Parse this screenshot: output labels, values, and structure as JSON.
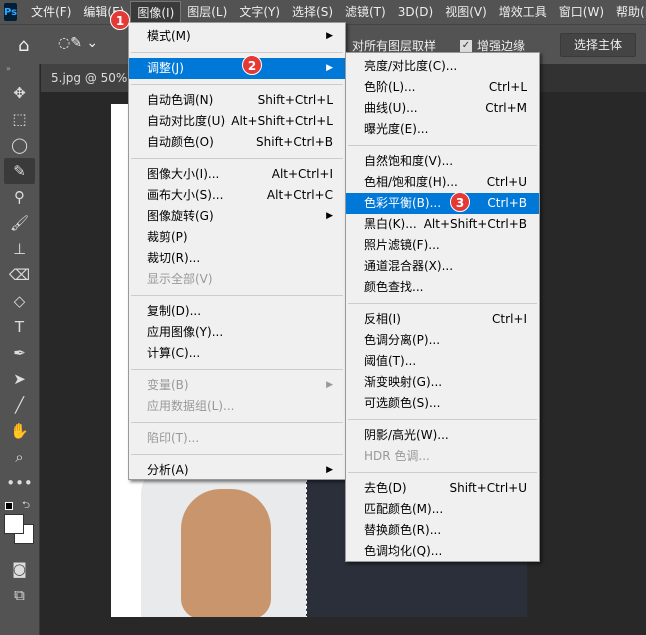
{
  "menubar": {
    "logo": "Ps",
    "items": [
      "文件(F)",
      "编辑(E)",
      "图像(I)",
      "图层(L)",
      "文字(Y)",
      "选择(S)",
      "滤镜(T)",
      "3D(D)",
      "视图(V)",
      "增效工具",
      "窗口(W)",
      "帮助(H)"
    ]
  },
  "options": {
    "sample_all_layers": "对所有图层取样",
    "enhance_edge": "增强边缘",
    "select_subject": "选择主体"
  },
  "tab": {
    "title": "5.jpg @ 50%(..."
  },
  "menu1": [
    {
      "label": "模式(M)",
      "shortcut": "",
      "sub": true
    },
    "sep",
    {
      "label": "调整(J)",
      "shortcut": "",
      "sub": true,
      "hl": true
    },
    "sep",
    {
      "label": "自动色调(N)",
      "shortcut": "Shift+Ctrl+L"
    },
    {
      "label": "自动对比度(U)",
      "shortcut": "Alt+Shift+Ctrl+L"
    },
    {
      "label": "自动颜色(O)",
      "shortcut": "Shift+Ctrl+B"
    },
    "sep",
    {
      "label": "图像大小(I)...",
      "shortcut": "Alt+Ctrl+I"
    },
    {
      "label": "画布大小(S)...",
      "shortcut": "Alt+Ctrl+C"
    },
    {
      "label": "图像旋转(G)",
      "shortcut": "",
      "sub": true
    },
    {
      "label": "裁剪(P)",
      "shortcut": ""
    },
    {
      "label": "裁切(R)...",
      "shortcut": ""
    },
    {
      "label": "显示全部(V)",
      "shortcut": "",
      "dis": true
    },
    "sep",
    {
      "label": "复制(D)...",
      "shortcut": ""
    },
    {
      "label": "应用图像(Y)...",
      "shortcut": ""
    },
    {
      "label": "计算(C)...",
      "shortcut": ""
    },
    "sep",
    {
      "label": "变量(B)",
      "shortcut": "",
      "sub": true,
      "dis": true
    },
    {
      "label": "应用数据组(L)...",
      "shortcut": "",
      "dis": true
    },
    "sep",
    {
      "label": "陷印(T)...",
      "shortcut": "",
      "dis": true
    },
    "sep",
    {
      "label": "分析(A)",
      "shortcut": "",
      "sub": true
    }
  ],
  "menu2": [
    {
      "label": "亮度/对比度(C)...",
      "shortcut": ""
    },
    {
      "label": "色阶(L)...",
      "shortcut": "Ctrl+L"
    },
    {
      "label": "曲线(U)...",
      "shortcut": "Ctrl+M"
    },
    {
      "label": "曝光度(E)...",
      "shortcut": ""
    },
    "sep",
    {
      "label": "自然饱和度(V)...",
      "shortcut": ""
    },
    {
      "label": "色相/饱和度(H)...",
      "shortcut": "Ctrl+U"
    },
    {
      "label": "色彩平衡(B)...",
      "shortcut": "Ctrl+B",
      "hl": true
    },
    {
      "label": "黑白(K)...",
      "shortcut": "Alt+Shift+Ctrl+B"
    },
    {
      "label": "照片滤镜(F)...",
      "shortcut": ""
    },
    {
      "label": "通道混合器(X)...",
      "shortcut": ""
    },
    {
      "label": "颜色查找...",
      "shortcut": ""
    },
    "sep",
    {
      "label": "反相(I)",
      "shortcut": "Ctrl+I"
    },
    {
      "label": "色调分离(P)...",
      "shortcut": ""
    },
    {
      "label": "阈值(T)...",
      "shortcut": ""
    },
    {
      "label": "渐变映射(G)...",
      "shortcut": ""
    },
    {
      "label": "可选颜色(S)...",
      "shortcut": ""
    },
    "sep",
    {
      "label": "阴影/高光(W)...",
      "shortcut": ""
    },
    {
      "label": "HDR 色调...",
      "shortcut": "",
      "dis": true
    },
    "sep",
    {
      "label": "去色(D)",
      "shortcut": "Shift+Ctrl+U"
    },
    {
      "label": "匹配颜色(M)...",
      "shortcut": ""
    },
    {
      "label": "替换颜色(R)...",
      "shortcut": ""
    },
    {
      "label": "色调均化(Q)...",
      "shortcut": ""
    }
  ],
  "badges": [
    "1",
    "2",
    "3"
  ],
  "tools": [
    {
      "icon": "move-icon",
      "glyph": "✥"
    },
    {
      "icon": "marquee-icon",
      "glyph": "⬚"
    },
    {
      "icon": "lasso-icon",
      "glyph": "◯"
    },
    {
      "icon": "quick-select-icon",
      "glyph": "✎",
      "sel": true
    },
    {
      "icon": "eyedropper-icon",
      "glyph": "⚲"
    },
    {
      "icon": "brush-icon",
      "glyph": "🖌"
    },
    {
      "icon": "stamp-icon",
      "glyph": "⊥"
    },
    {
      "icon": "eraser-icon",
      "glyph": "⌫"
    },
    {
      "icon": "paint-bucket-icon",
      "glyph": "◇"
    },
    {
      "icon": "type-icon",
      "glyph": "T"
    },
    {
      "icon": "pen-icon",
      "glyph": "✒"
    },
    {
      "icon": "path-select-icon",
      "glyph": "➤"
    },
    {
      "icon": "line-icon",
      "glyph": "╱"
    },
    {
      "icon": "hand-icon",
      "glyph": "✋"
    },
    {
      "icon": "zoom-icon",
      "glyph": "⌕"
    },
    {
      "icon": "more-tools-icon",
      "glyph": "•••"
    }
  ]
}
